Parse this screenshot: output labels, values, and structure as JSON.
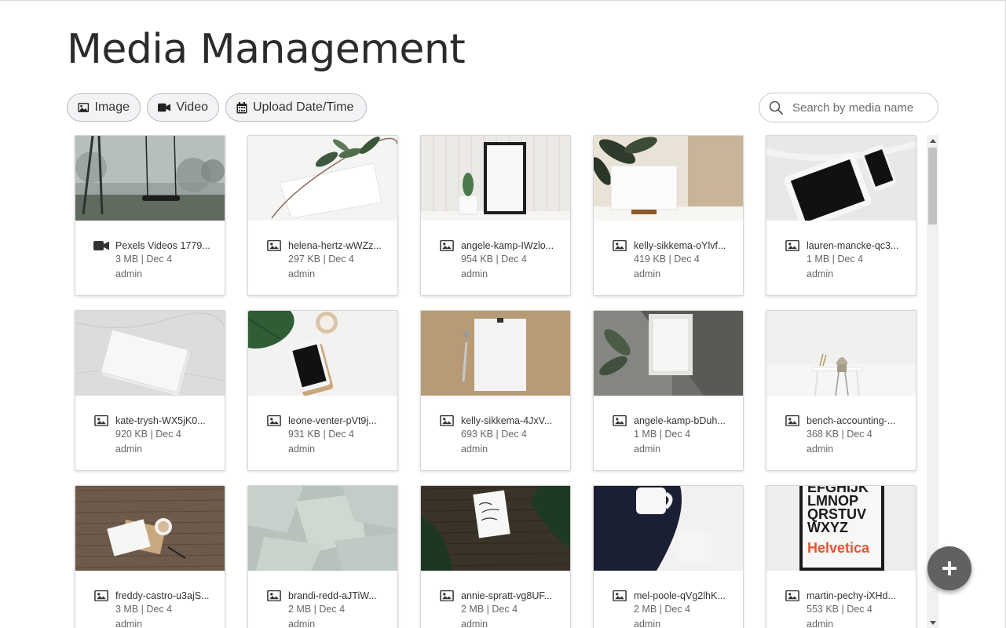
{
  "page": {
    "title": "Media Management"
  },
  "filters": {
    "image_label": "Image",
    "video_label": "Video",
    "date_label": "Upload Date/Time"
  },
  "search": {
    "placeholder": "Search by media name",
    "value": ""
  },
  "media": [
    {
      "type": "video",
      "name": "Pexels Videos 1779...",
      "size": "3 MB",
      "date": "Dec 4",
      "uploader": "admin",
      "thumb": "foggy-swing"
    },
    {
      "type": "image",
      "name": "helena-hertz-wWZz...",
      "size": "297 KB",
      "date": "Dec 4",
      "uploader": "admin",
      "thumb": "leaf-tag"
    },
    {
      "type": "image",
      "name": "angele-kamp-IWzlo...",
      "size": "954 KB",
      "date": "Dec 4",
      "uploader": "admin",
      "thumb": "frame-cactus"
    },
    {
      "type": "image",
      "name": "kelly-sikkema-oYlvf...",
      "size": "419 KB",
      "date": "Dec 4",
      "uploader": "admin",
      "thumb": "card-plant"
    },
    {
      "type": "image",
      "name": "lauren-mancke-qc3...",
      "size": "1 MB",
      "date": "Dec 4",
      "uploader": "admin",
      "thumb": "tablet-phone"
    },
    {
      "type": "image",
      "name": "kate-trysh-WX5jK0...",
      "size": "920 KB",
      "date": "Dec 4",
      "uploader": "admin",
      "thumb": "cards-marble"
    },
    {
      "type": "image",
      "name": "leone-venter-pVt9j...",
      "size": "931 KB",
      "date": "Dec 4",
      "uploader": "admin",
      "thumb": "phone-monstera"
    },
    {
      "type": "image",
      "name": "kelly-sikkema-4JxV...",
      "size": "693 KB",
      "date": "Dec 4",
      "uploader": "admin",
      "thumb": "paper-kraft"
    },
    {
      "type": "image",
      "name": "angele-kamp-bDuh...",
      "size": "1 MB",
      "date": "Dec 4",
      "uploader": "admin",
      "thumb": "frame-gray"
    },
    {
      "type": "image",
      "name": "bench-accounting-...",
      "size": "368 KB",
      "date": "Dec 4",
      "uploader": "admin",
      "thumb": "desk-chair"
    },
    {
      "type": "image",
      "name": "freddy-castro-u3ajS...",
      "size": "3 MB",
      "date": "Dec 4",
      "uploader": "admin",
      "thumb": "wood-coffee"
    },
    {
      "type": "image",
      "name": "brandi-redd-aJTiW...",
      "size": "2 MB",
      "date": "Dec 4",
      "uploader": "admin",
      "thumb": "paper-sheets"
    },
    {
      "type": "image",
      "name": "annie-spratt-vg8UF...",
      "size": "2 MB",
      "date": "Dec 4",
      "uploader": "admin",
      "thumb": "card-palm"
    },
    {
      "type": "image",
      "name": "mel-poole-qVg2lhK...",
      "size": "2 MB",
      "date": "Dec 4",
      "uploader": "admin",
      "thumb": "mugs-navy"
    },
    {
      "type": "image",
      "name": "martin-pechy-iXHd...",
      "size": "553 KB",
      "date": "Dec 4",
      "uploader": "admin",
      "thumb": "helvetica-poster"
    }
  ],
  "thumb_text": {
    "poster_lines": [
      "EFGHIJK",
      "LMNOP",
      "QRSTUV",
      "WXYZ"
    ],
    "poster_brand": "Helvetica"
  },
  "colors": {
    "fab": "#616161",
    "chip_bg": "#f1f3f5",
    "chip_border": "#b9bcc2"
  },
  "icons": {
    "filter_image": "image-icon",
    "filter_video": "video-camera-icon",
    "filter_date": "calendar-icon",
    "search": "search-icon",
    "fab": "plus-icon"
  }
}
